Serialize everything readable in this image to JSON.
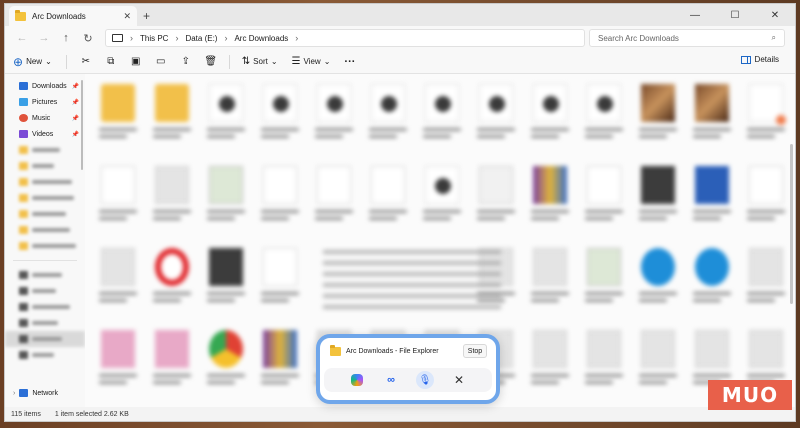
{
  "window": {
    "tab_title": "Arc Downloads",
    "new_tab": "+",
    "minimize": "—",
    "maximize": "☐",
    "close": "✕"
  },
  "address": {
    "crumbs": [
      "This PC",
      "Data (E:)",
      "Arc Downloads"
    ],
    "search_placeholder": "Search Arc Downloads"
  },
  "toolbar": {
    "new_label": "New",
    "sort_label": "Sort",
    "view_label": "View",
    "more_label": "···",
    "details_label": "Details"
  },
  "sidebar": {
    "items": [
      {
        "label": "Downloads",
        "icon": "downloads-icon",
        "color": "#2b6fd6",
        "pinned": true
      },
      {
        "label": "Pictures",
        "icon": "pictures-icon",
        "color": "#3aa0e6",
        "pinned": true
      },
      {
        "label": "Music",
        "icon": "music-icon",
        "color": "#e0533b",
        "pinned": true
      },
      {
        "label": "Videos",
        "icon": "videos-icon",
        "color": "#7b4bd6",
        "pinned": true
      }
    ],
    "network_label": "Network"
  },
  "status": {
    "count": "115 items",
    "selection": "1 item selected  2.62 KB"
  },
  "copilot": {
    "title": "Arc Downloads - File Explorer",
    "stop_label": "Stop"
  },
  "watermark": "MUO",
  "colors": {
    "accent": "#1d67c6",
    "copilot_border": "#6fa6ea",
    "watermark_bg": "#e8604a"
  }
}
